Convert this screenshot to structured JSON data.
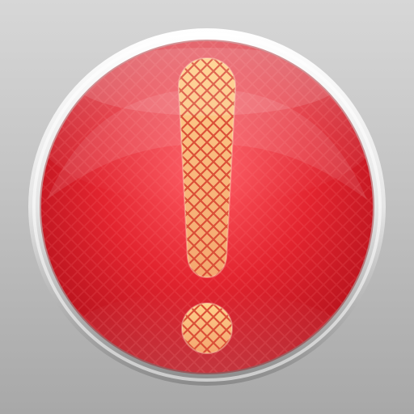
{
  "icon": {
    "name": "alert-exclamation-icon",
    "colors": {
      "background_top": "#d7d7d7",
      "background_bottom": "#a8a8a8",
      "bezel_light": "#ffffff",
      "bezel_dark": "#8b8b8b",
      "button_red": "#e3242f",
      "button_red_dark": "#b5121c",
      "button_red_light": "#ff5a62",
      "mark_light": "#ffd08a",
      "mark_mid": "#f4a66f",
      "mark_pattern": "#d94a33"
    }
  }
}
